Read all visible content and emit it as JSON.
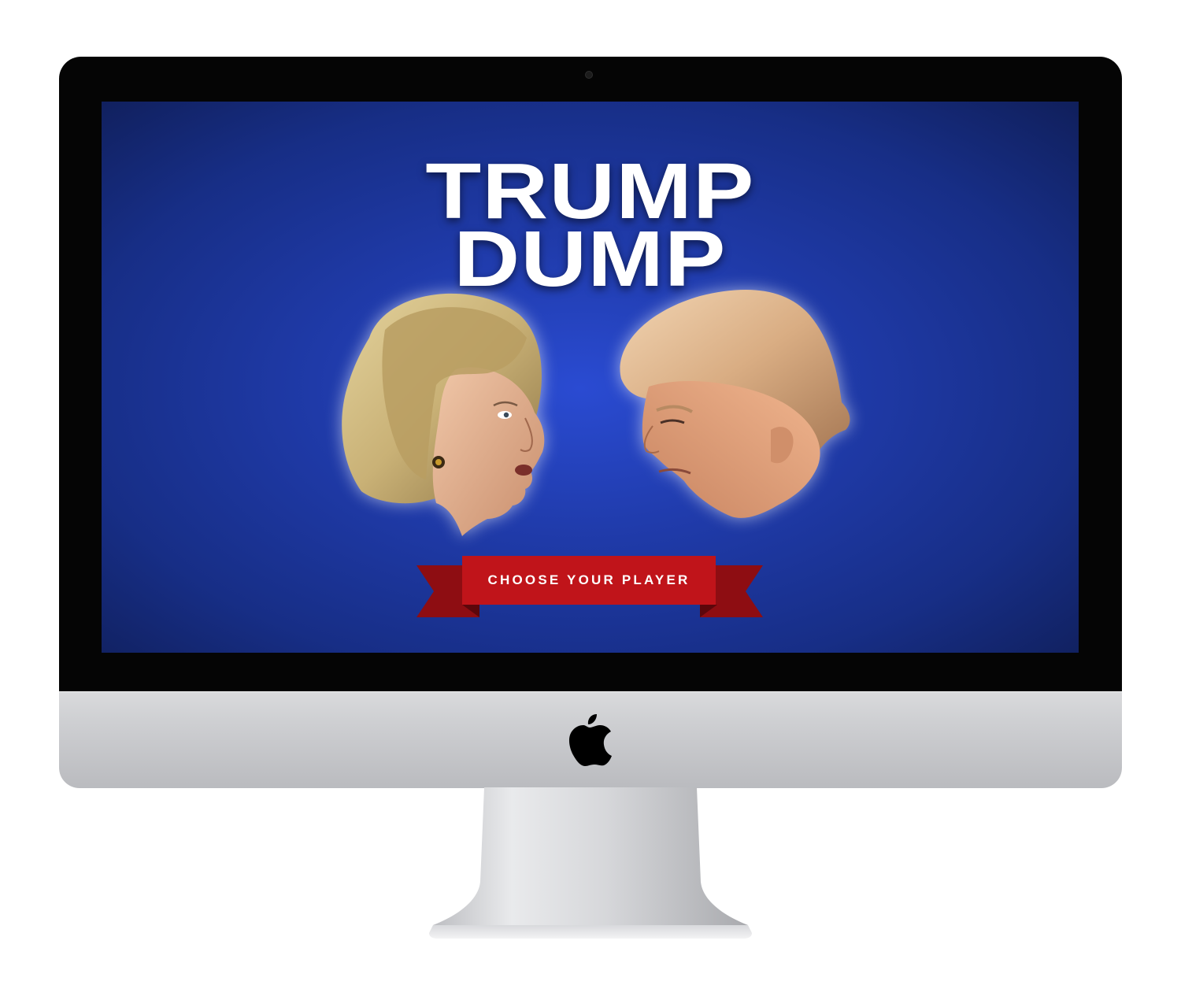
{
  "game": {
    "title_line_1": "TRUMP",
    "title_line_2": "DUMP",
    "cta_label": "CHOOSE YOUR PLAYER"
  },
  "players": [
    {
      "icon": "player-left-portrait-icon"
    },
    {
      "icon": "player-right-portrait-icon"
    }
  ],
  "colors": {
    "screen_center": "#2a4bd2",
    "screen_edge": "#101f5b",
    "banner_red": "#c0141a",
    "banner_dark_red": "#8e0d12",
    "title_text": "#ffffff"
  },
  "device": {
    "logo": "apple-logo-icon"
  }
}
